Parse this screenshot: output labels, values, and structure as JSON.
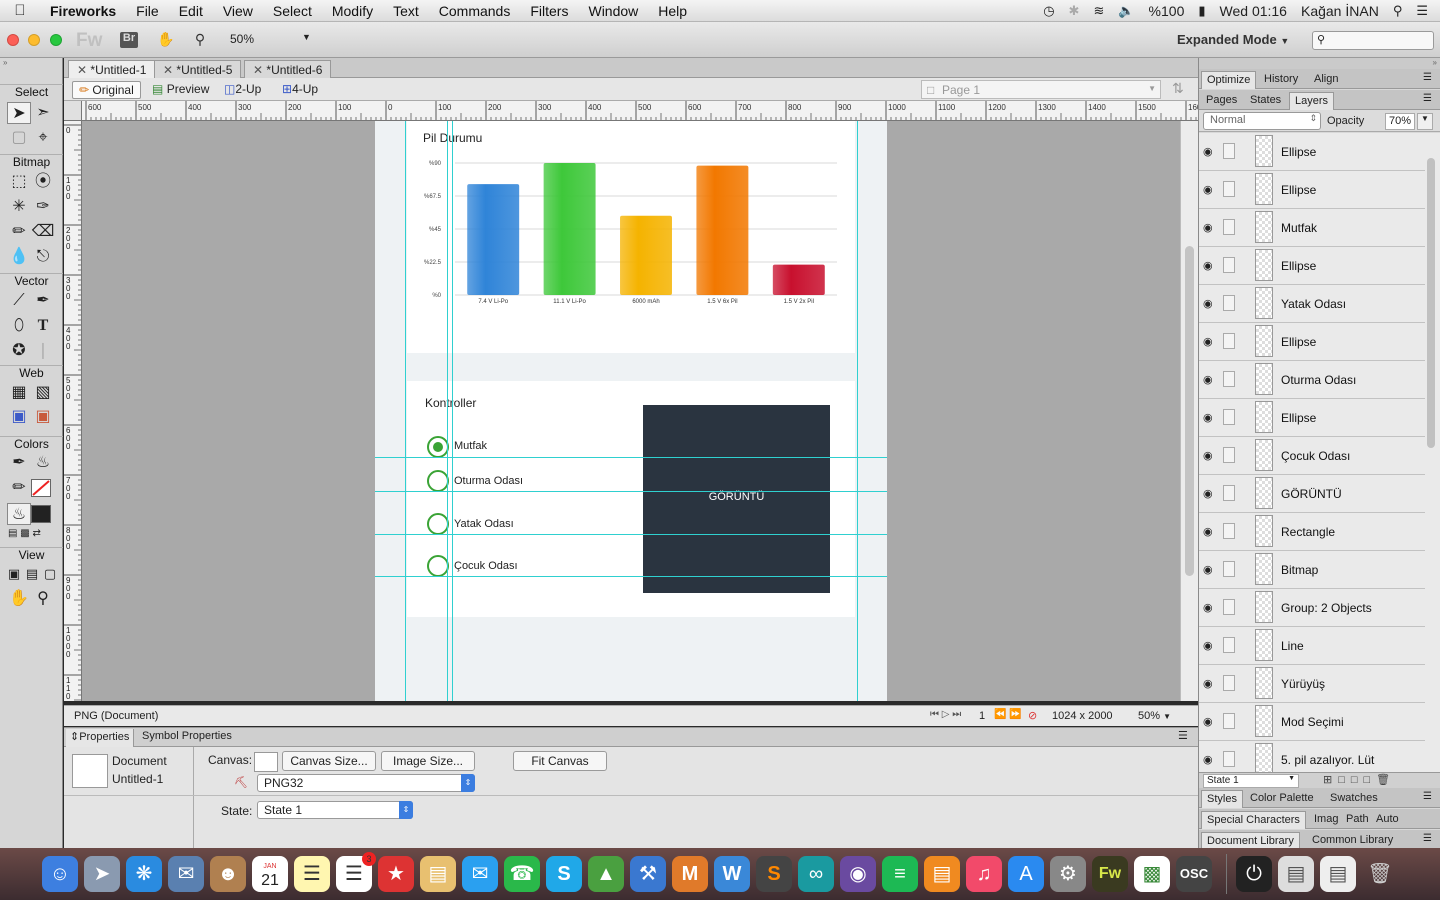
{
  "menubar": {
    "app_name": "Fireworks",
    "items": [
      "File",
      "Edit",
      "View",
      "Select",
      "Modify",
      "Text",
      "Commands",
      "Filters",
      "Window",
      "Help"
    ],
    "battery": "%100",
    "clock": "Wed 01:16",
    "user": "Kağan İNAN"
  },
  "toolbar": {
    "logo": "Fw",
    "bridge": "Br",
    "zoom": "50%",
    "mode": "Expanded Mode"
  },
  "tools": {
    "sections": [
      "Select",
      "Bitmap",
      "Vector",
      "Web",
      "Colors",
      "View"
    ]
  },
  "doc_tabs": [
    "*Untitled-1",
    "*Untitled-5",
    "*Untitled-6"
  ],
  "view_bar": {
    "buttons": [
      "Original",
      "Preview",
      "2-Up",
      "4-Up"
    ],
    "page": "Page 1"
  },
  "ruler": {
    "h_labels": [
      "600",
      "500",
      "400",
      "300",
      "200",
      "100",
      "0",
      "100",
      "200",
      "300",
      "400",
      "500",
      "600",
      "700",
      "800",
      "900",
      "1000",
      "1100",
      "1200",
      "1300",
      "1400",
      "1500",
      "160"
    ],
    "v_labels": [
      "0",
      "100",
      "200",
      "300",
      "400",
      "500",
      "600",
      "700",
      "800",
      "900",
      "1000",
      "1100",
      "1200"
    ]
  },
  "canvas": {
    "chart_title": "Pil Durumu",
    "controls_title": "Kontroller",
    "radios": [
      {
        "label": "Mutfak",
        "checked": true
      },
      {
        "label": "Oturma Odası",
        "checked": false
      },
      {
        "label": "Yatak Odası",
        "checked": false
      },
      {
        "label": "Çocuk Odası",
        "checked": false
      }
    ],
    "image_label": "GÖRÜNTÜ"
  },
  "chart_data": {
    "type": "bar",
    "title": "Pil Durumu",
    "categories": [
      "7.4 V Li-Po",
      "11.1 V Li-Po",
      "6000 mAh",
      "1.5 V 6x Pil",
      "1.5 V 2x Pil"
    ],
    "values": [
      84,
      100,
      60,
      98,
      23
    ],
    "y_tick_labels": [
      "%0",
      "%22.5",
      "%45",
      "%67.5",
      "%90"
    ],
    "colors": [
      "#2f84d8",
      "#3ec83a",
      "#f5b300",
      "#f27800",
      "#c8102e"
    ],
    "grid": true
  },
  "statusbar": {
    "doc": "PNG (Document)",
    "frame": "1",
    "size": "1024 x 2000",
    "zoom": "50%"
  },
  "properties": {
    "tabs": [
      "Properties",
      "Symbol Properties"
    ],
    "doc_label": "Document",
    "doc_name": "Untitled-1",
    "canvas_label": "Canvas:",
    "canvas_size_btn": "Canvas Size...",
    "image_size_btn": "Image Size...",
    "fit_canvas_btn": "Fit Canvas",
    "format": "PNG32",
    "state_label": "State:",
    "state": "State 1"
  },
  "panels": {
    "top_tabs": [
      "Optimize",
      "History",
      "Align"
    ],
    "layer_tabs": [
      "Pages",
      "States",
      "Layers"
    ],
    "blend": "Normal",
    "opacity_label": "Opacity",
    "opacity": "70%",
    "layers": [
      "Ellipse",
      "Ellipse",
      "Mutfak",
      "Ellipse",
      "Yatak Odası",
      "Ellipse",
      "Oturma Odası",
      "Ellipse",
      "Çocuk Odası",
      "GÖRÜNTÜ",
      "Rectangle",
      "Bitmap",
      "Group: 2 Objects",
      "Line",
      "Yürüyüş",
      "Mod  Seçimi",
      "5. pil azalıyor. Lüt"
    ],
    "state_footer": "State 1",
    "bottom_rows": [
      [
        "Styles",
        "Color Palette",
        "Swatches"
      ],
      [
        "Special Characters",
        "Imag",
        "Path",
        "Auto"
      ],
      [
        "Document Library",
        "Common Library"
      ]
    ]
  },
  "dock": {
    "calendar_month": "JAN",
    "calendar_day": "21",
    "badge": "3",
    "fw": "Fw",
    "osc": "OSC"
  }
}
